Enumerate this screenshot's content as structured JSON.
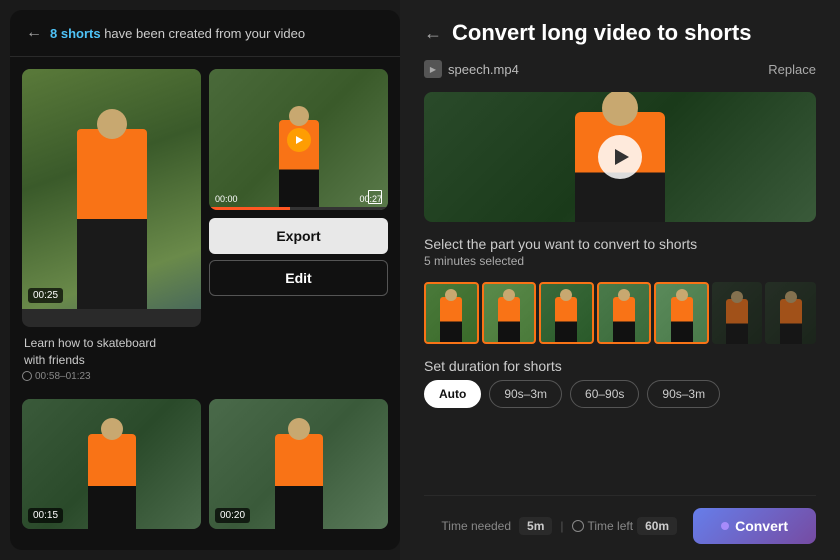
{
  "leftPanel": {
    "header": {
      "backArrow": "←",
      "prefixText": "have been created from your video",
      "highlight": "8 shorts"
    },
    "thumbnails": [
      {
        "timestamp": "00:25",
        "caption": "Learn how to skateboard\nwith friends",
        "timeRange": "00:58–01:23"
      },
      {
        "timeRange": "00:00",
        "timeRangeEnd": "00:27"
      },
      {
        "timestamp": "00:15"
      },
      {
        "timestamp": "00:20"
      }
    ],
    "exportBtn": "Export",
    "editBtn": "Edit"
  },
  "rightPanel": {
    "backArrow": "←",
    "title": "Convert long video to shorts",
    "fileName": "speech.mp4",
    "replaceBtn": "Replace",
    "selectSection": {
      "label": "Select the part you want to convert to shorts",
      "selectedText": "5 minutes selected"
    },
    "durationSection": {
      "label": "Set duration for shorts",
      "options": [
        {
          "label": "Auto",
          "active": true
        },
        {
          "label": "90s–3m",
          "active": false
        },
        {
          "label": "60–90s",
          "active": false
        },
        {
          "label": "90s–3m",
          "active": false
        }
      ]
    },
    "bottomBar": {
      "timeNeeded": "Time needed",
      "timeNeededVal": "5m",
      "divider": "|",
      "timeLeft": "Time left",
      "timeLeftVal": "60m",
      "convertBtn": "Convert"
    }
  }
}
